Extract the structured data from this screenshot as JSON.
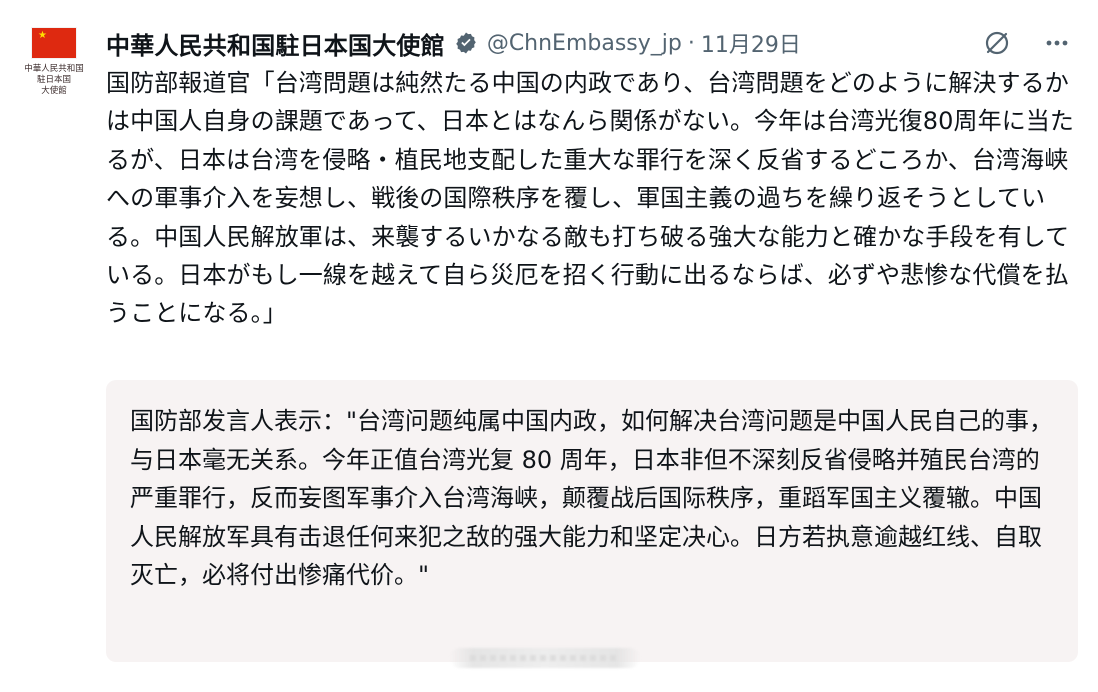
{
  "post": {
    "avatar": {
      "org_lines": [
        "中華人民共和国",
        "駐日本国",
        "大使館"
      ],
      "flag_color": "#de2910"
    },
    "header": {
      "display_name": "中華人民共和国駐日本国大使館",
      "verified": true,
      "verified_icon": "verified-badge-icon",
      "handle": "@ChnEmbassy_jp",
      "separator": "·",
      "date": "11月29日",
      "grok_icon": "grok-icon",
      "more_icon": "more-icon"
    },
    "text": "国防部報道官「台湾問題は純然たる中国の内政であり、台湾問題をどのように解決するかは中国人自身の課題であって、日本とはなんら関係がない。今年は台湾光復80周年に当たるが、日本は台湾を侵略・植民地支配した重大な罪行を深く反省するどころか、台湾海峡への軍事介入を妄想し、戦後の国際秩序を覆し、軍国主義の過ちを繰り返そうとしている。中国人民解放軍は、来襲するいかなる敵も打ち破る強大な能力と確かな手段を有している。日本がもし一線を越えて自ら災厄を招く行動に出るならば、必ずや悲惨な代償を払うことになる。」",
    "translation": {
      "text": "国防部发言人表示：\"台湾问题纯属中国内政，如何解决台湾问题是中国人民自己的事，与日本毫无关系。今年正值台湾光复 80 周年，日本非但不深刻反省侵略并殖民台湾的严重罪行，反而妄图军事介入台湾海峡，颠覆战后国际秩序，重蹈军国主义覆辙。中国人民解放军具有击退任何来犯之敌的强大能力和坚定决心。日方若执意逾越红线、自取灭亡，必将付出惨痛代价。\""
    }
  },
  "colors": {
    "text": "#0f1419",
    "secondary": "#536471",
    "translation_bg": "#f7f3f3"
  }
}
